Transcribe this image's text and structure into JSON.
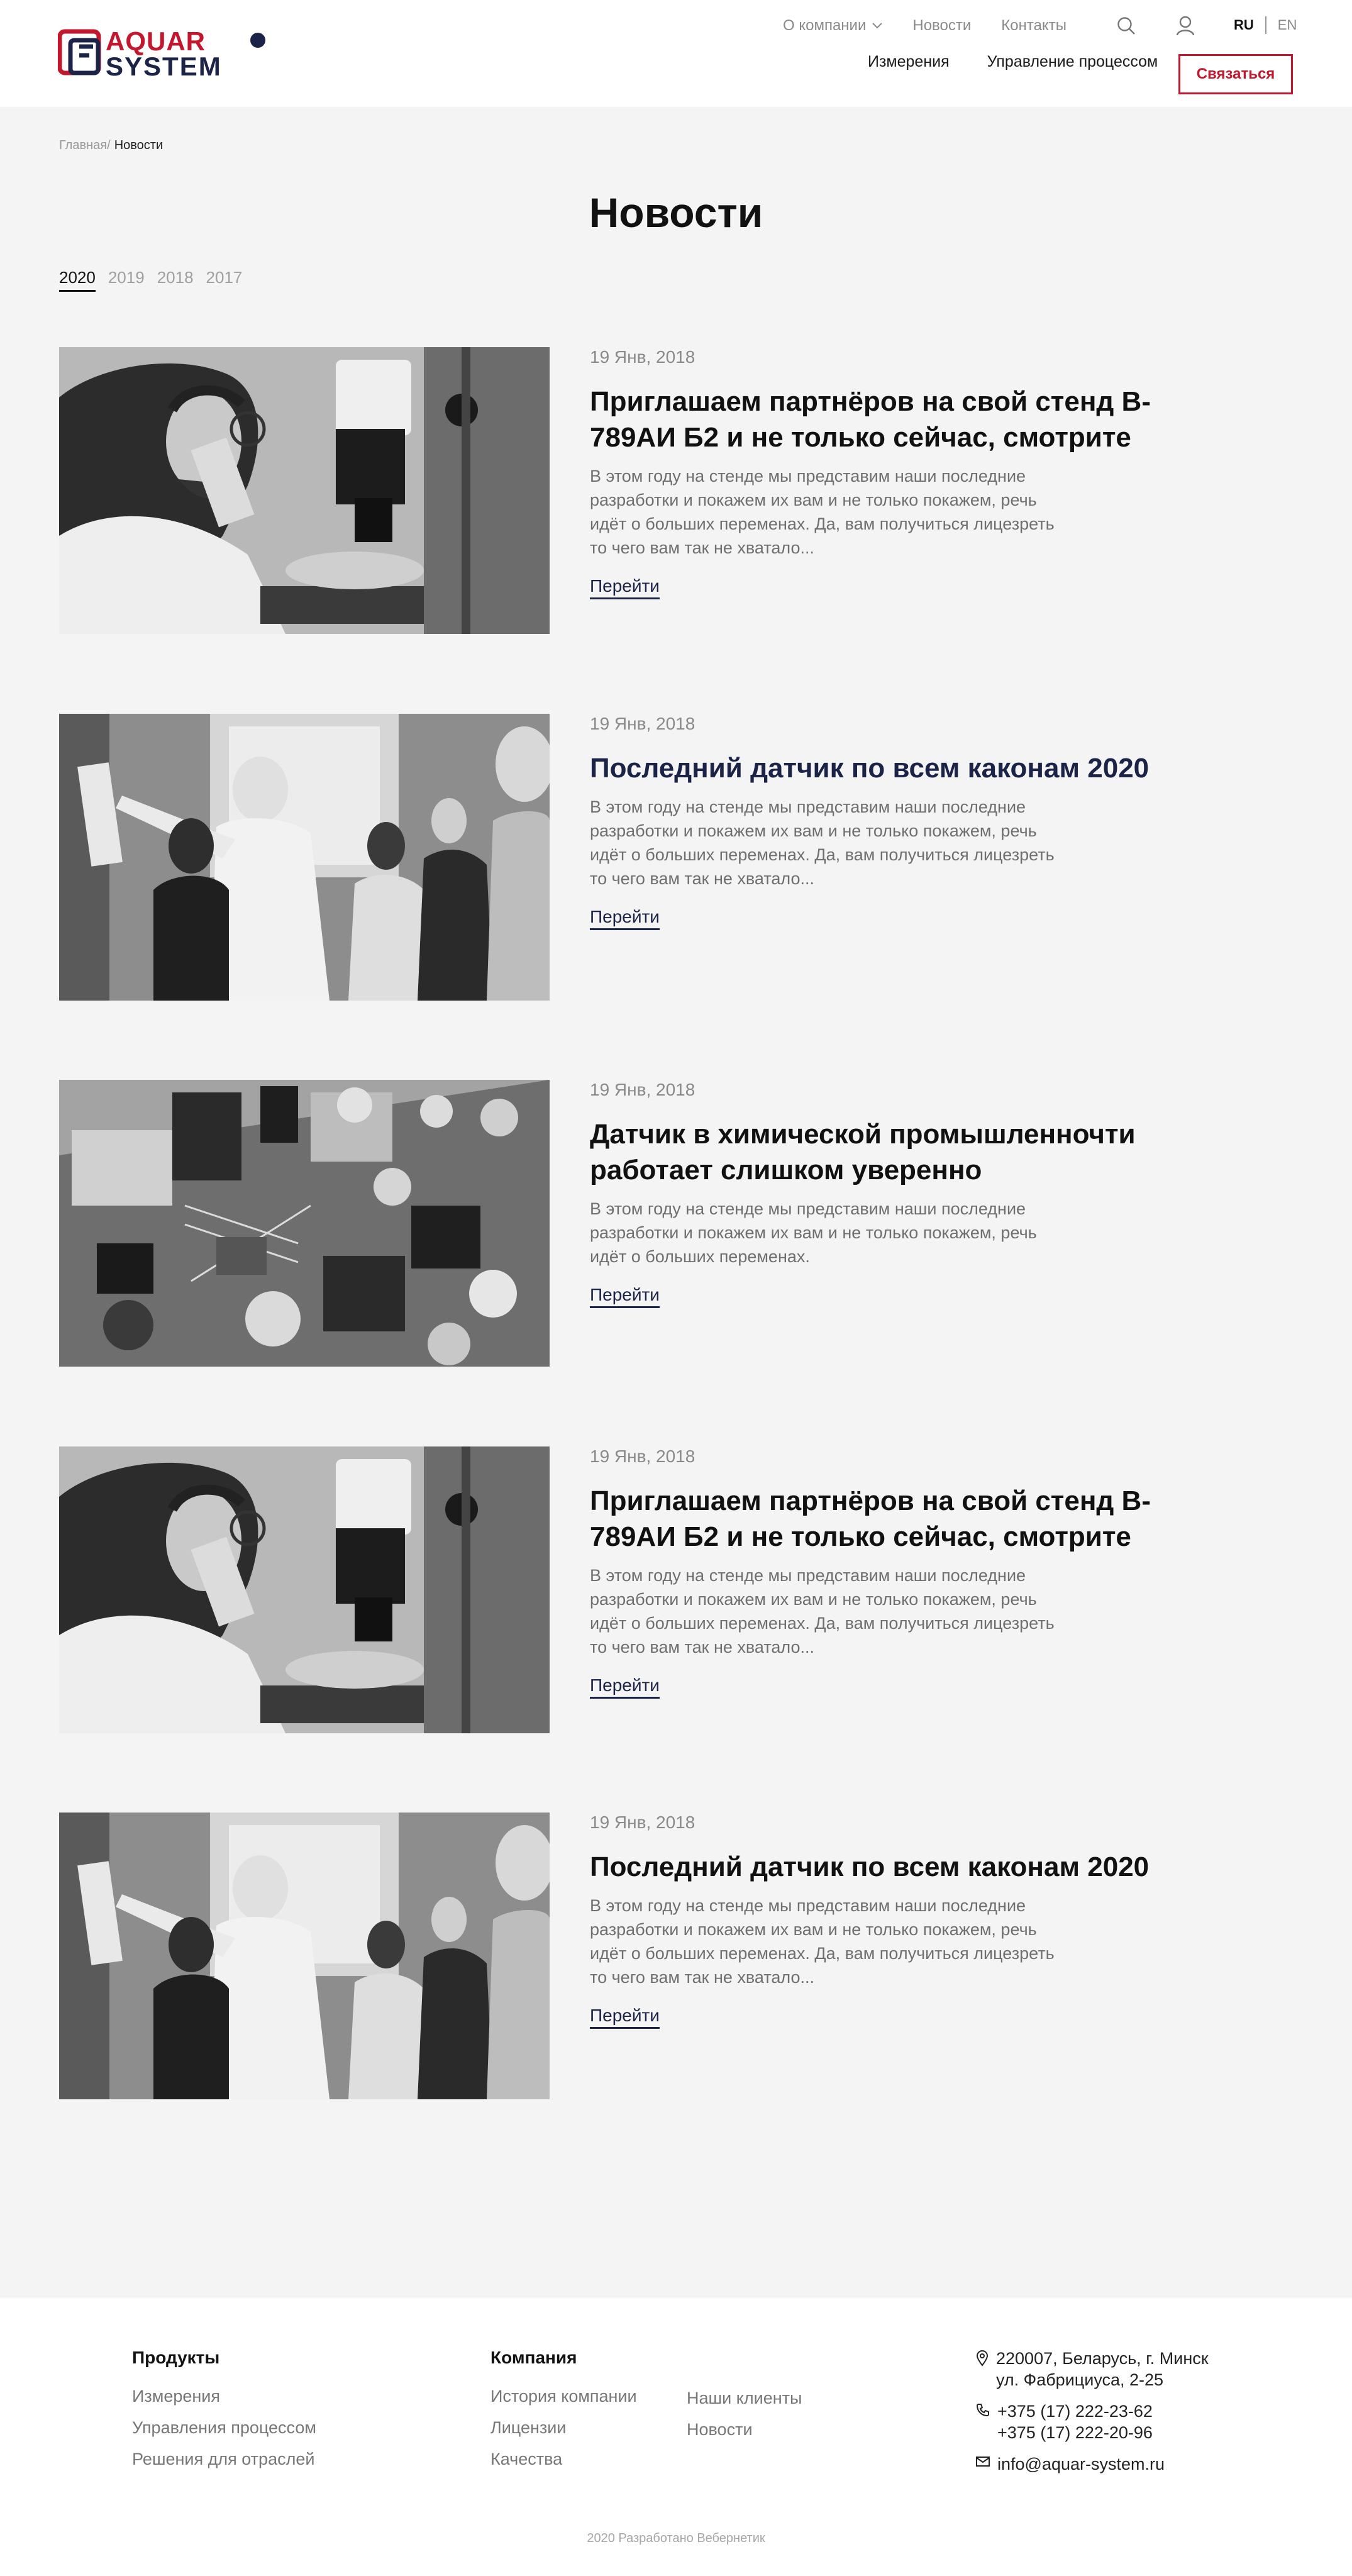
{
  "brand": {
    "logo_line1": "AQUAR",
    "logo_line2": "SYSTEM",
    "primary_color": "#1b2347",
    "accent_color": "#c3172e"
  },
  "header": {
    "top_nav": [
      {
        "label": "О компании",
        "has_dropdown": true
      },
      {
        "label": "Новости"
      },
      {
        "label": "Контакты"
      }
    ],
    "icons": [
      "search-icon",
      "user-icon"
    ],
    "lang": {
      "active": "RU",
      "other": "EN"
    },
    "main_nav": [
      "Измерения",
      "Управление процессом"
    ],
    "contact_button": "Связаться"
  },
  "breadcrumb": {
    "home": "Главная/",
    "current": "Новости"
  },
  "page_title": "Новости",
  "years": [
    {
      "label": "2020",
      "active": true
    },
    {
      "label": "2019"
    },
    {
      "label": "2018"
    },
    {
      "label": "2017"
    }
  ],
  "news": [
    {
      "date": "19 Янв, 2018",
      "title": "Приглашаем партнёров на свой стенд B-789АИ Б2 и не только сейчас, смотрите",
      "text": "В этом году на стенде мы представим наши последние разработки и покажем их вам и не только покажем, речь идёт о больших переменах. Да, вам получиться лицезреть то чего вам так не хватало...",
      "link": "Перейти",
      "image": "microscope"
    },
    {
      "date": "19 Янв, 2018",
      "title": "Последний датчик по всем каконам 2020",
      "text": "В этом году на стенде мы представим наши последние разработки и покажем их вам и не только покажем, речь идёт о больших переменах. Да, вам получиться лицезреть то чего вам так не хватало...",
      "link": "Перейти",
      "image": "lab-group"
    },
    {
      "date": "19 Янв, 2018",
      "title": "Датчик в химической промышленночти работает слишком уверенно",
      "text": "В этом году на стенде мы представим наши последние разработки и покажем их вам и не только покажем, речь идёт о больших переменах.",
      "link": "Перейти",
      "image": "circuit-board"
    },
    {
      "date": "19 Янв, 2018",
      "title": "Приглашаем партнёров на свой стенд B-789АИ Б2 и не только сейчас, смотрите",
      "text": "В этом году на стенде мы представим наши последние разработки и покажем их вам и не только покажем, речь идёт о больших переменах. Да, вам получиться лицезреть то чего вам так не хватало...",
      "link": "Перейти",
      "image": "microscope"
    },
    {
      "date": "19 Янв, 2018",
      "title": "Последний датчик по всем каконам 2020",
      "text": "В этом году на стенде мы представим наши последние разработки и покажем их вам и не только покажем, речь идёт о больших переменах. Да, вам получиться лицезреть то чего вам так не хватало...",
      "link": "Перейти",
      "image": "lab-group"
    }
  ],
  "footer": {
    "products": {
      "title": "Продукты",
      "links": [
        "Измерения",
        "Управления процессом",
        "Решения для отраслей"
      ]
    },
    "company": {
      "title": "Компания",
      "links_col1": [
        "История компании",
        "Лицензии",
        "Качества"
      ],
      "links_col2": [
        "Наши клиенты",
        "Новости"
      ]
    },
    "contacts": {
      "address": [
        "220007, Беларусь, г. Минск",
        "ул. Фабрициуса, 2-25"
      ],
      "phones": [
        "+375 (17) 222-23-62",
        "+375 (17) 222-20-96"
      ],
      "email": "info@aquar-system.ru"
    },
    "copyright": "2020 Разработано Вебернетик"
  }
}
